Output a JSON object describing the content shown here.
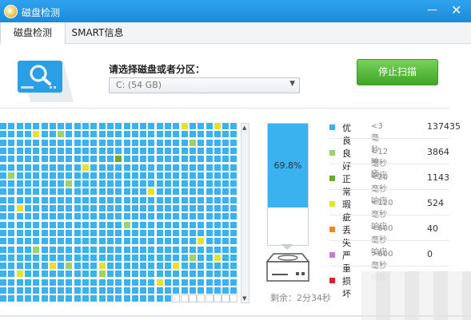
{
  "window": {
    "title": "磁盘检测",
    "minimize_icon": "minimize-icon",
    "close_icon": "close-icon"
  },
  "tabs": [
    {
      "label": "磁盘检测",
      "active": true
    },
    {
      "label": "SMART信息",
      "active": false
    }
  ],
  "disk_selector": {
    "label": "请选择磁盘或者分区：",
    "selected": "C:  (54 GB)"
  },
  "scan_button": {
    "label": "停止扫描"
  },
  "progress": {
    "percent_label": "69.8%",
    "fraction": 0.698,
    "remaining": "剩余：2分34秒"
  },
  "colors": {
    "accent": "#1b8ad9",
    "excellent": "#39b2ef",
    "good": "#9bd36b",
    "normal": "#6aab2c",
    "flaw": "#e6e12e",
    "lost": "#f08a1e",
    "severe": "#c87ad6",
    "damaged": "#d9242a",
    "unscanned": "#ffffff"
  },
  "legend": [
    {
      "key": "excellent",
      "name": "优良",
      "desc": "<3毫秒响应",
      "count": "137435"
    },
    {
      "key": "good",
      "name": "良好",
      "desc": "<12毫秒响应",
      "count": "3864"
    },
    {
      "key": "normal",
      "name": "正常",
      "desc": "<20毫秒响应",
      "count": "1143"
    },
    {
      "key": "flaw",
      "name": "瑕疵",
      "desc": "<120毫秒响应",
      "count": "524"
    },
    {
      "key": "lost",
      "name": "丢失",
      "desc": "<600毫秒响应",
      "count": "40"
    },
    {
      "key": "severe",
      "name": "严重",
      "desc": ">600毫秒响应",
      "count": "0"
    },
    {
      "key": "damaged",
      "name": "损坏",
      "desc": "",
      "count": ""
    }
  ],
  "grid": {
    "rows": 22,
    "cols": 29,
    "marks": [
      {
        "r": 0,
        "c": 22,
        "key": "flaw"
      },
      {
        "r": 0,
        "c": 26,
        "key": "flaw"
      },
      {
        "r": 1,
        "c": 4,
        "key": "flaw"
      },
      {
        "r": 1,
        "c": 7,
        "key": "good"
      },
      {
        "r": 2,
        "c": 23,
        "key": "good"
      },
      {
        "r": 4,
        "c": 14,
        "key": "normal"
      },
      {
        "r": 5,
        "c": 10,
        "key": "flaw"
      },
      {
        "r": 6,
        "c": 1,
        "key": "good"
      },
      {
        "r": 7,
        "c": 8,
        "key": "good"
      },
      {
        "r": 8,
        "c": 18,
        "key": "flaw"
      },
      {
        "r": 10,
        "c": 2,
        "key": "flaw"
      },
      {
        "r": 12,
        "c": 15,
        "key": "good"
      },
      {
        "r": 14,
        "c": 24,
        "key": "flaw"
      },
      {
        "r": 15,
        "c": 4,
        "key": "good"
      },
      {
        "r": 16,
        "c": 23,
        "key": "good"
      },
      {
        "r": 16,
        "c": 26,
        "key": "flaw"
      },
      {
        "r": 17,
        "c": 6,
        "key": "flaw"
      },
      {
        "r": 17,
        "c": 8,
        "key": "good"
      },
      {
        "r": 17,
        "c": 12,
        "key": "flaw"
      },
      {
        "r": 17,
        "c": 21,
        "key": "flaw"
      },
      {
        "r": 18,
        "c": 2,
        "key": "flaw"
      },
      {
        "r": 18,
        "c": 12,
        "key": "good"
      },
      {
        "r": 19,
        "c": 19,
        "key": "flaw"
      }
    ],
    "unscanned_from": {
      "r": 21,
      "c": 21
    }
  }
}
